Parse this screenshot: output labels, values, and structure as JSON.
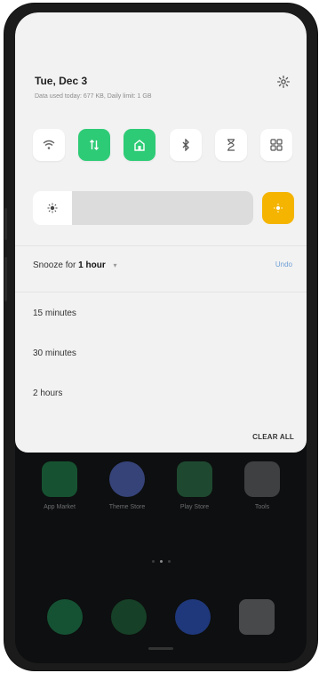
{
  "header": {
    "date": "Tue, Dec 3",
    "data_usage": "Data used today: 677 KB, Daily limit: 1 GB"
  },
  "quick_tiles": [
    {
      "name": "wifi-icon",
      "glyph": "≋",
      "active": false
    },
    {
      "name": "mobile-data-icon",
      "glyph": "⇅",
      "active": true
    },
    {
      "name": "hotspot-icon",
      "glyph": "⌂",
      "active": true
    },
    {
      "name": "bluetooth-icon",
      "glyph": "ᛒ",
      "active": false
    },
    {
      "name": "hourglass-icon",
      "glyph": "⧗",
      "active": false
    },
    {
      "name": "apps-grid-icon",
      "glyph": "⊞",
      "active": false
    }
  ],
  "brightness": {
    "level": 0.0,
    "auto_color": "#f4b400"
  },
  "snooze": {
    "prefix": "Snooze for",
    "value": "1 hour",
    "undo": "Undo",
    "options": [
      "15 minutes",
      "30 minutes",
      "2 hours"
    ]
  },
  "clear_all": "CLEAR ALL",
  "home": {
    "apps": [
      {
        "label": "App Market",
        "color": "#1f8a4c"
      },
      {
        "label": "Theme Store",
        "color": "#5a6fd0"
      },
      {
        "label": "Play Store",
        "color": "#2d7a4a"
      },
      {
        "label": "Tools",
        "color": "#6a6a6a"
      }
    ],
    "dock": [
      {
        "name": "phone-icon",
        "color": "#1d8a52"
      },
      {
        "name": "messages-icon",
        "color": "#1f6a3a"
      },
      {
        "name": "browser-icon",
        "color": "#2f5bd3"
      },
      {
        "name": "camera-icon",
        "color": "#7a7a7a"
      }
    ]
  },
  "colors": {
    "accent_green": "#2ecb76",
    "accent_yellow": "#f4b400",
    "shade_bg": "#f2f2f2"
  }
}
